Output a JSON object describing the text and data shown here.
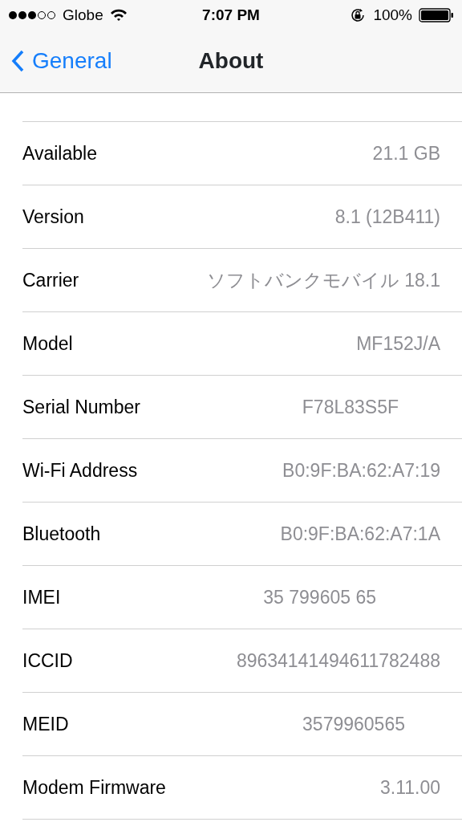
{
  "status_bar": {
    "carrier": "Globe",
    "time": "7:07 PM",
    "battery": "100%"
  },
  "nav": {
    "back": "General",
    "title": "About"
  },
  "rows": [
    {
      "label": "Available",
      "value": "21.1 GB"
    },
    {
      "label": "Version",
      "value": "8.1 (12B411)"
    },
    {
      "label": "Carrier",
      "value": "ソフトバンクモバイル 18.1"
    },
    {
      "label": "Model",
      "value": "MF152J/A"
    },
    {
      "label": "Serial Number",
      "value": "F78L83S5F"
    },
    {
      "label": "Wi-Fi Address",
      "value": "B0:9F:BA:62:A7:19"
    },
    {
      "label": "Bluetooth",
      "value": "B0:9F:BA:62:A7:1A"
    },
    {
      "label": "IMEI",
      "value": "35 799605 65"
    },
    {
      "label": "ICCID",
      "value": "89634141494611782488"
    },
    {
      "label": "MEID",
      "value": "3579960565"
    },
    {
      "label": "Modem Firmware",
      "value": "3.11.00"
    }
  ]
}
